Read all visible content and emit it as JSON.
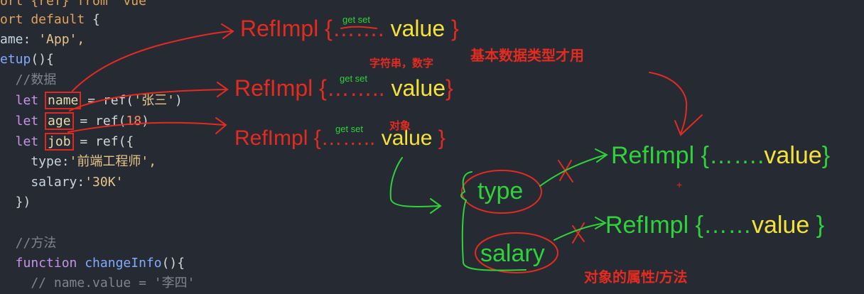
{
  "code": {
    "l0": "ort {ref} from 'vue'",
    "l1_kw": "ort default",
    "l1_rest": " {",
    "l2_prop": "ame:",
    "l2_str": " 'App',",
    "l3_fn": "etup",
    "l3_rest": "(){",
    "l4": "  //数据",
    "l5_kw": "  let ",
    "l5_var": "name",
    "l5_mid": " = ref(",
    "l5_str": "'张三'",
    "l5_end": ")",
    "l6_kw": "  let ",
    "l6_var": "age",
    "l6_mid": " = ref(",
    "l6_num": "18",
    "l6_end": ")",
    "l7_kw": "  let ",
    "l7_var": "job",
    "l7_mid": " = ref({",
    "l8_prop": "    type:",
    "l8_str": "'前端工程师',",
    "l9_prop": "    salary:",
    "l9_str": "'30K'",
    "l10": "  })",
    "l11": "",
    "l12": "  //方法",
    "l13_kw": "  function ",
    "l13_fn": "changeInfo",
    "l13_rest": "(){",
    "l14": "    // name.value = '李四'"
  },
  "annotations": {
    "ref1_a": "RefImpl {",
    "ref1_b": "…….",
    "ref1_c": "value",
    "ref1_d": "}",
    "ref1_getset": "get set",
    "ref2_a": "RefImpl {",
    "ref2_b": "……..",
    "ref2_c": "value",
    "ref2_d": "}",
    "ref2_getset": "get set",
    "ref3_a": "RefImpl {",
    "ref3_b": "……..",
    "ref3_c": "value",
    "ref3_d": "}",
    "ref3_getset": "get set",
    "note_basic": "基本数据类型才用",
    "note_strnum": "字符串，数字",
    "note_object": "对象",
    "type_word": "type",
    "salary_word": "salary",
    "ref4_a": "RefImpl {",
    "ref4_b": "…….",
    "ref4_c": "value",
    "ref4_d": "}",
    "ref5_a": "RefImpl {",
    "ref5_b": "……",
    "ref5_c": "value",
    "ref5_d": "}",
    "note_props": "对象的属性/方法",
    "plus": "+"
  },
  "colors": {
    "background": "#262a33",
    "ink_red": "#e42b20",
    "ink_yellow": "#f4e23a",
    "ink_green": "#2fd23a"
  }
}
